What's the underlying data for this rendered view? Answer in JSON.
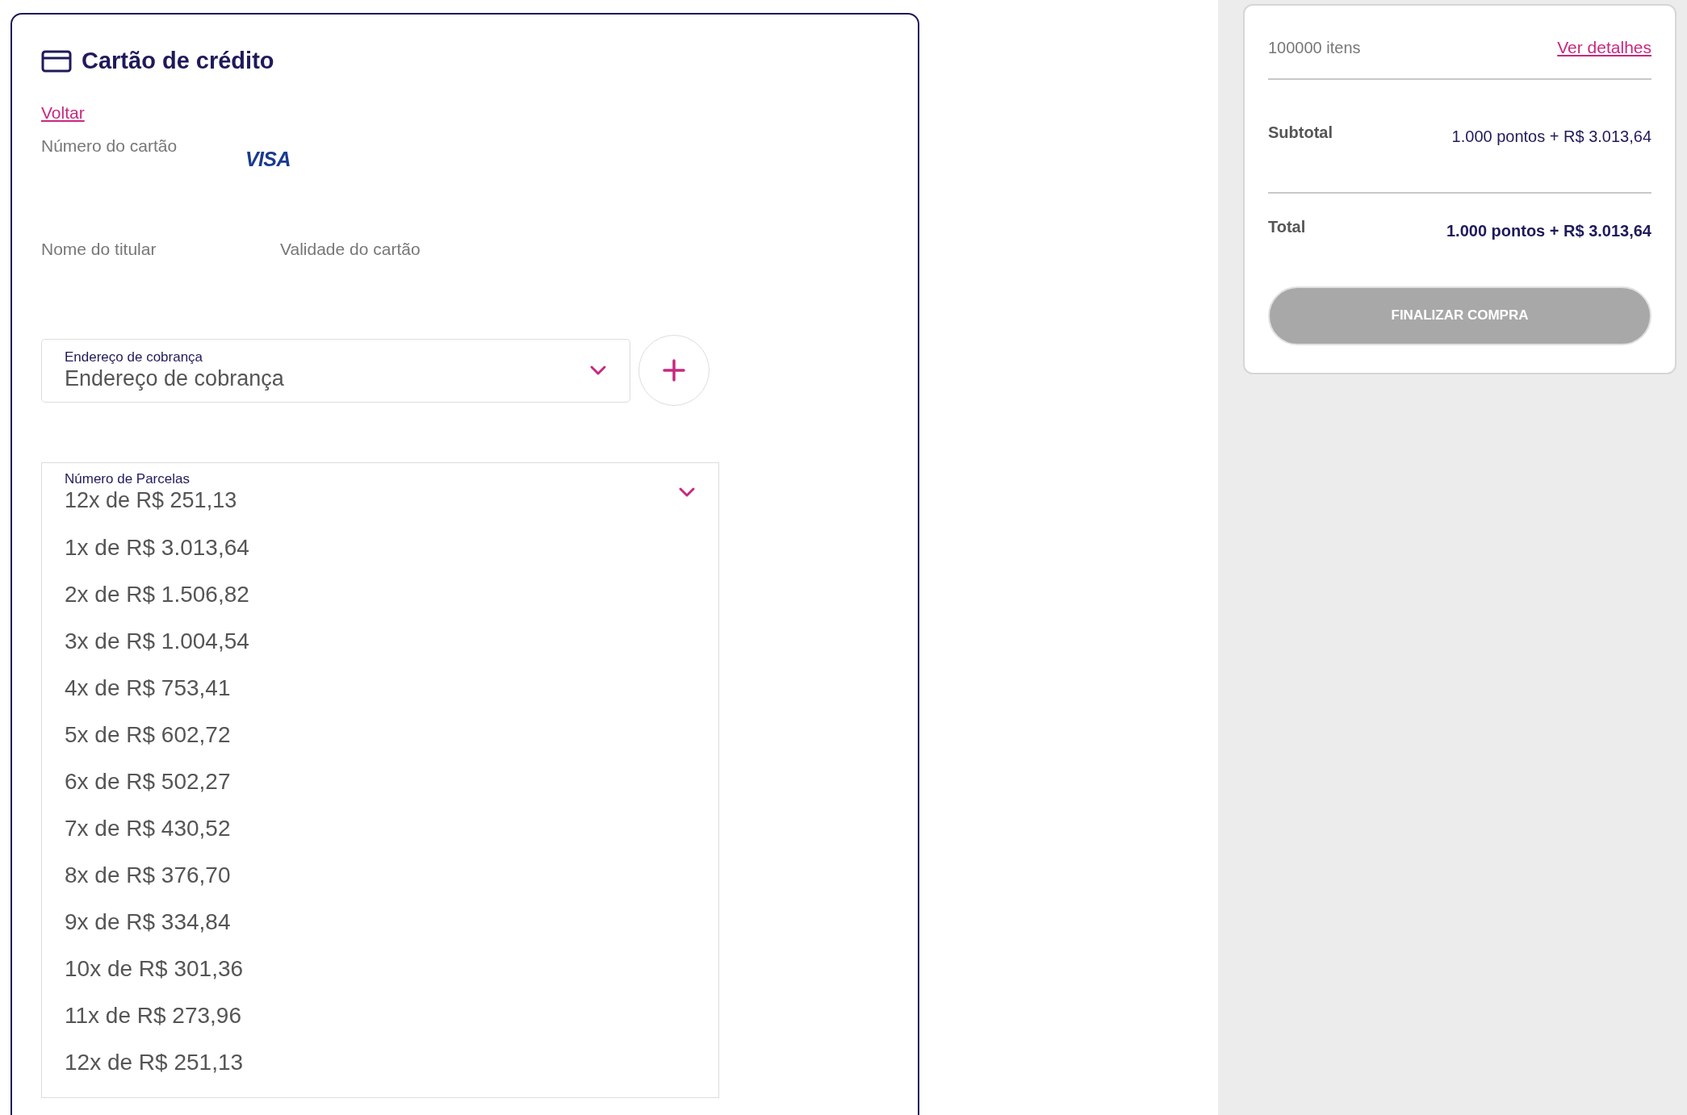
{
  "payment": {
    "title": "Cartão de crédito",
    "back_link": "Voltar",
    "card_number_label": "Número do cartão",
    "card_brand": "VISA",
    "holder_label": "Nome do titular",
    "expiry_label": "Validade do cartão",
    "billing_address": {
      "label": "Endereço de cobrança",
      "value": "Endereço de cobrança"
    },
    "installments": {
      "label": "Número de Parcelas",
      "value": "12x de R$ 251,13",
      "expanded": true,
      "options": [
        "1x de R$ 3.013,64",
        "2x de R$ 1.506,82",
        "3x de R$ 1.004,54",
        "4x de R$ 753,41",
        "5x de R$ 602,72",
        "6x de R$ 502,27",
        "7x de R$ 430,52",
        "8x de R$ 376,70",
        "9x de R$ 334,84",
        "10x de R$ 301,36",
        "11x de R$ 273,96",
        "12x de R$ 251,13"
      ]
    }
  },
  "summary": {
    "items_count": "100000 itens",
    "details_link": "Ver detalhes",
    "subtotal_label": "Subtotal",
    "subtotal_value": "1.000 pontos + R$ 3.013,64",
    "total_label": "Total",
    "total_value": "1.000 pontos + R$ 3.013,64",
    "checkout_button": {
      "label": "FINALIZAR COMPRA",
      "disabled": true
    }
  }
}
